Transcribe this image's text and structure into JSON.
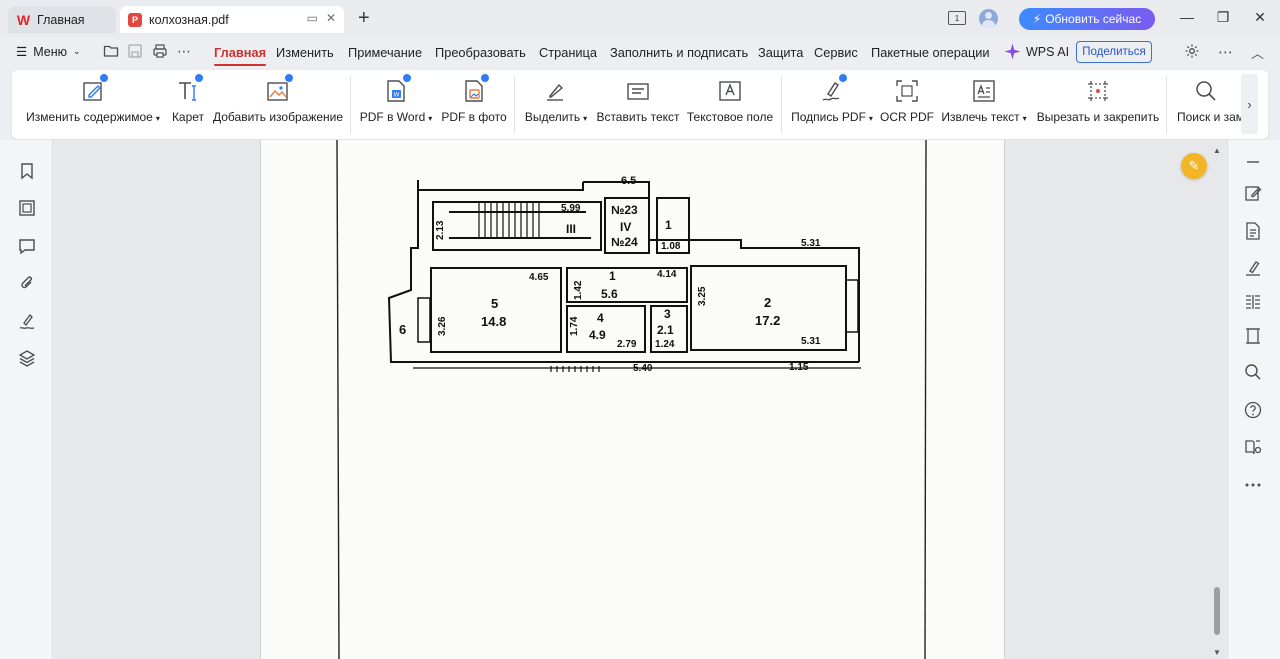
{
  "tabs": {
    "home": {
      "label": "Главная",
      "logo": "W"
    },
    "doc": {
      "label": "колхозная.pdf",
      "logo": "P"
    },
    "new_tab": "+"
  },
  "titlebar": {
    "upgrade_label": "Обновить сейчас",
    "slide_badge": "1",
    "minimize": "—",
    "restore": "❐",
    "close": "✕"
  },
  "menubar": {
    "menu_label": "Меню",
    "tabs": [
      {
        "label": "Главная",
        "active": true
      },
      {
        "label": "Изменить"
      },
      {
        "label": "Примечание"
      },
      {
        "label": "Преобразовать"
      },
      {
        "label": "Страница"
      },
      {
        "label": "Заполнить и подписать"
      },
      {
        "label": "Защита"
      },
      {
        "label": "Сервис"
      },
      {
        "label": "Пакетные операции"
      }
    ],
    "wps_ai": "WPS AI",
    "share": "Поделиться"
  },
  "ribbon": {
    "items": [
      {
        "label": "Изменить содержимое",
        "icon": "edit-content-icon",
        "dropdown": true
      },
      {
        "label": "Карет",
        "icon": "text-caret-icon"
      },
      {
        "label": "Добавить изображение",
        "icon": "add-image-icon"
      },
      {
        "label": "PDF в Word",
        "icon": "pdf-to-word-icon",
        "dropdown": true
      },
      {
        "label": "PDF в фото",
        "icon": "pdf-to-image-icon"
      },
      {
        "label": "Выделить",
        "icon": "highlight-icon",
        "dropdown": true
      },
      {
        "label": "Вставить текст",
        "icon": "insert-text-icon"
      },
      {
        "label": "Текстовое поле",
        "icon": "text-box-icon"
      },
      {
        "label": "Подпись PDF",
        "icon": "signature-icon",
        "dropdown": true
      },
      {
        "label": "OCR PDF",
        "icon": "ocr-icon"
      },
      {
        "label": "Извлечь текст",
        "icon": "extract-text-icon",
        "dropdown": true
      },
      {
        "label": "Вырезать и закрепить",
        "icon": "crop-pin-icon"
      },
      {
        "label": "Поиск и зам",
        "icon": "search-replace-icon"
      }
    ]
  },
  "floorplan": {
    "labels": [
      "6.5",
      "5.99",
      "III",
      "№23",
      "IV",
      "№24",
      "1",
      "1.08",
      "5.31",
      "2.13",
      "4.65",
      "1.42",
      "1",
      "5.6",
      "4.14",
      "3.25",
      "5",
      "14.8",
      "6",
      "3.26",
      "1.74",
      "4",
      "4.9",
      "2.79",
      "3",
      "2.1",
      "1.24",
      "2",
      "17.2",
      "5.31",
      "5.40",
      "1.15"
    ]
  },
  "colors": {
    "accent_red": "#d0312d",
    "upgrade_gradient_start": "#3d8bfd",
    "upgrade_gradient_end": "#7a5bf0",
    "edit_fab": "#f3b525"
  }
}
